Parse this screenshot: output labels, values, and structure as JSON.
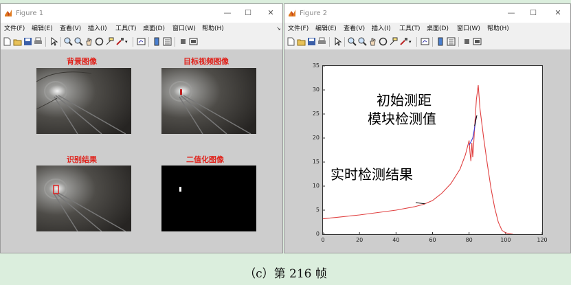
{
  "figure1": {
    "title": "Figure 1",
    "menu": [
      "文件(F)",
      "编辑(E)",
      "查看(V)",
      "插入(I)",
      "工具(T)",
      "桌面(D)",
      "窗口(W)",
      "帮助(H)"
    ],
    "panels": {
      "background_title": "背景图像",
      "target_title": "目标视频图像",
      "result_title": "识别结果",
      "binary_title": "二值化图像"
    }
  },
  "figure2": {
    "title": "Figure 2",
    "menu": [
      "文件(F)",
      "编辑(E)",
      "查看(V)",
      "插入(I)",
      "工具(T)",
      "桌面(D)",
      "窗口(W)",
      "帮助(H)"
    ]
  },
  "window_controls": {
    "minimize": "—",
    "maximize": "☐",
    "close": "✕"
  },
  "annotations": {
    "initial_line1": "初始测距",
    "initial_line2": "模块检测值",
    "realtime": "实时检测结果"
  },
  "caption": "（c）第 216 帧",
  "colors": {
    "panel_title": "#e0231c",
    "realtime_series": "#e04040",
    "initial_series": "#3a3ad8"
  },
  "chart_data": {
    "type": "line",
    "xlim": [
      0,
      120
    ],
    "ylim": [
      0,
      35
    ],
    "xticks": [
      0,
      20,
      40,
      60,
      80,
      100,
      120
    ],
    "yticks": [
      0,
      5,
      10,
      15,
      20,
      25,
      30,
      35
    ],
    "grid": false,
    "series": [
      {
        "name": "实时检测结果",
        "x": [
          0,
          10,
          20,
          30,
          40,
          50,
          55,
          60,
          65,
          70,
          75,
          78,
          79,
          80,
          80.5,
          81,
          81.5,
          82,
          82.5,
          83,
          84,
          85,
          86,
          88,
          90,
          92,
          94,
          96,
          98,
          100,
          102,
          104
        ],
        "y": [
          3.2,
          3.6,
          4.0,
          4.5,
          5.0,
          5.7,
          6.2,
          7.0,
          8.5,
          10.5,
          13.5,
          16.5,
          18.0,
          19.5,
          17.0,
          15.2,
          19.0,
          16.0,
          18.5,
          22.0,
          28.0,
          31.0,
          26.0,
          20.0,
          14.5,
          9.5,
          5.5,
          2.5,
          0.8,
          0.3,
          0.1,
          0.0
        ]
      },
      {
        "name": "初始测距模块检测值",
        "x": [
          80,
          81,
          82,
          83,
          84
        ],
        "y": [
          18.5,
          19.2,
          20.0,
          22.0,
          24.5
        ]
      }
    ]
  }
}
